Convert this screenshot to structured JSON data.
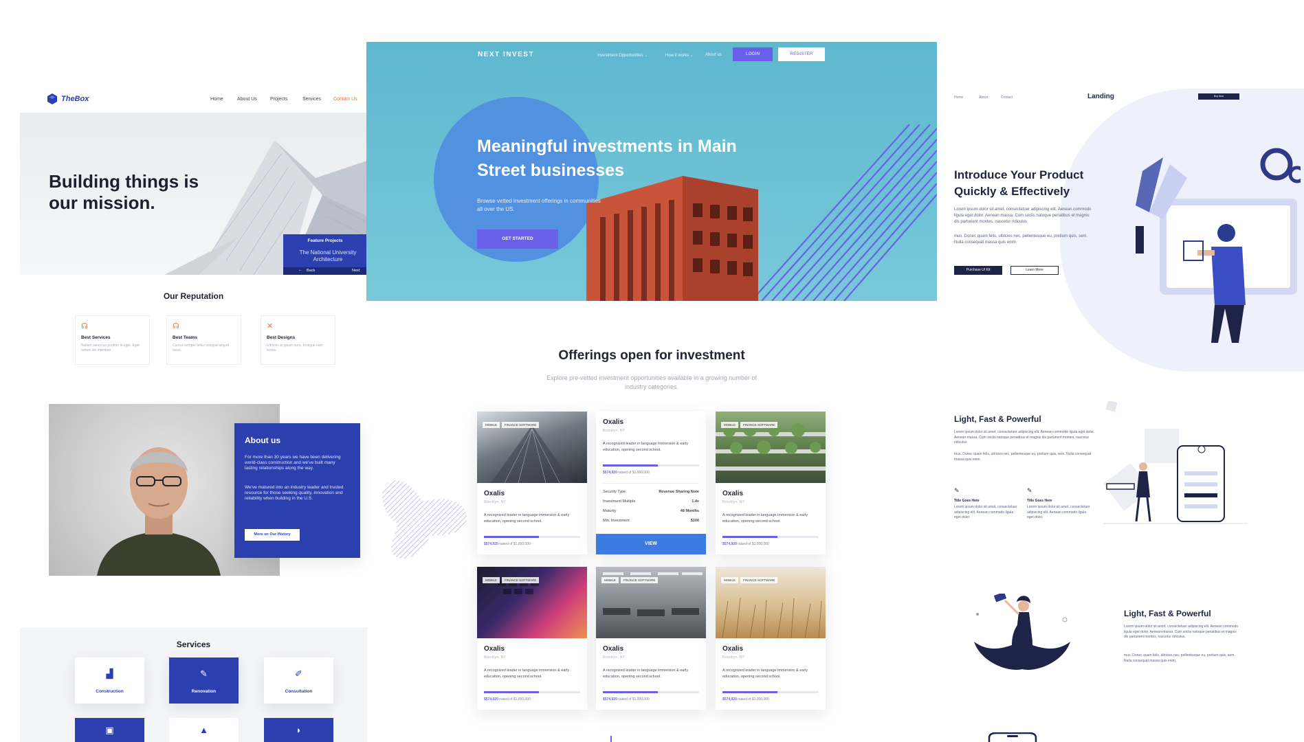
{
  "thebox": {
    "logo": "TheBox",
    "nav": [
      "Home",
      "About Us",
      "Projects",
      "Services",
      "Contact Us"
    ],
    "hero_title": "Building things is our mission.",
    "feature": {
      "title": "Feature Projects",
      "name": "The National University Architecture",
      "back": "Back",
      "next": "Next"
    },
    "reputation_title": "Our Reputation",
    "reputation": [
      {
        "title": "Best Services",
        "desc": "Nullam senectus porttitor in eget. Eget rutrum leo interdum."
      },
      {
        "title": "Best Teams",
        "desc": "Cursus semper tellus volutpat aliquet lacus."
      },
      {
        "title": "Best Designs",
        "desc": "Ultricies at ipsum nunc, tristique nam lectus."
      }
    ],
    "about": {
      "title": "About us",
      "p1": "For more than 30 years we have been delivering world-class construction and we've built many lasting relationships along the way.",
      "p2": "We've matured into an industry leader and trusted resource for those seeking quality, innovation and reliability when building in the U.S.",
      "button": "More on Our History"
    },
    "services_title": "Services",
    "services": [
      "Construction",
      "Renovation",
      "Consultation"
    ],
    "accent": "#2b3fae"
  },
  "invest": {
    "brand": "NEXT INVEST",
    "nav": [
      "Investment Opportunities ⌄",
      "How it works ⌄",
      "About us"
    ],
    "login": "LOGIN",
    "register": "REGISTER",
    "hero_title": "Meaningful investments in Main Street businesses",
    "hero_sub": "Browse vetted investment offerings in communities all over the US.",
    "cta": "GET STARTED",
    "offerings_title": "Offerings open for investment",
    "offerings_sub": "Explore pre-vetted investment opportunities available in a growing number of industry categories.",
    "tags": [
      "MOBILE",
      "FINANCE SOFTWARE"
    ],
    "offer_name": "Oxalis",
    "offer_loc": "Brooklyn, NY",
    "offer_desc": "A recognized leader in language immersion & early education, opening second school.",
    "raised_amount": "$574,920",
    "raised_text": "raised of $1,000,000",
    "raised_fraction": 0.57,
    "details": [
      {
        "k": "Security Type",
        "v": "Revenue Sharing Note"
      },
      {
        "k": "Investment Multiple",
        "v": "1.4x"
      },
      {
        "k": "Maturity",
        "v": "48 Months"
      },
      {
        "k": "Min. Investment",
        "v": "$100"
      }
    ],
    "view": "VIEW",
    "accent": "#6a5fe8",
    "view_color": "#3c7be0"
  },
  "landing": {
    "nav": [
      "Home",
      "About",
      "Contact"
    ],
    "brand": "Landing",
    "buy": "Buy Now",
    "hero_title": "Introduce Your Product Quickly & Effectively",
    "p1": "Lorem ipsum dolor sit amet, consectetuer adipiscing elit. Aenean commodo ligula eget dolor. Aenean massa. Cum sociis natoque penatibus et magnis dis parturient montes, nascetur ridiculus",
    "p2": "mus. Donec quam felis, ultricies nec, pellentesque eu, pretium quis, sem. Nulla consequat massa quis enim.",
    "btn1": "Purchase UI Kit",
    "btn2": "Learn More",
    "section1_title": "Light, Fast & Powerful",
    "section1_p1": "Lorem ipsum dolor sit amet, consectetuer adipiscing elit. Aenean commodo ligula eget dolor. Aenean massa. Cum sociis natoque penatibus et magnis dis parturient montes, nascetur ridiculus.",
    "section1_p2": "mus. Donec quam felis, ultricies nec, pellentesque eu, pretium quis, sem. Nulla consequat massa quis enim.",
    "feature_title": "Title Goes Here",
    "feature_desc": "Lorem ipsum dolor sit amet, consectetuer adipiscing elit. Aenean commodo ligula eget dolor.",
    "section2_title": "Light, Fast & Powerful",
    "section2_p1": "Lorem ipsum dolor sit amet, consectetuer adipiscing elit. Aenean commodo ligula eget dolor. Aenean massa. Cum sociis natoque penatibus et magnis dis parturient montes, nascetur ridiculus.",
    "section2_p2": "mus. Donec quam felis, ultricies nec, pellentesque eu, pretium quis, sem. Nulla consequat massa quis enim.",
    "accent": "#1e2447"
  }
}
